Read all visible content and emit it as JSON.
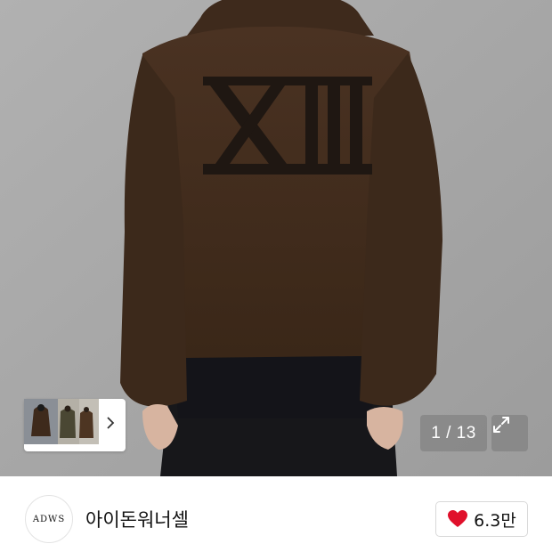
{
  "gallery": {
    "counter": "1 / 13",
    "thumbnails": [
      "thumb-1",
      "thumb-2",
      "thumb-3"
    ],
    "icons": {
      "next": "chevron-right-icon",
      "expand": "expand-icon"
    }
  },
  "brand": {
    "logo_text": "ADWS",
    "name": "아이돈워너셀"
  },
  "like": {
    "count": "6.3만",
    "icon": "heart-icon",
    "color": "#e0102b"
  }
}
